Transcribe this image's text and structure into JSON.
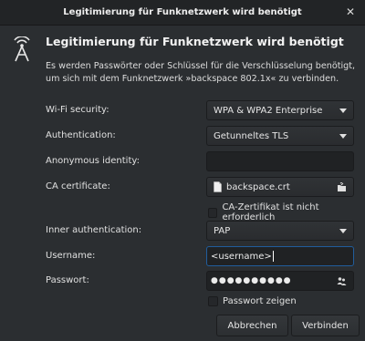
{
  "window": {
    "title": "Legitimierung für Funknetzwerk wird benötigt",
    "close_glyph": "✕"
  },
  "dialog": {
    "icon": "wifi-antenna-icon",
    "heading": "Legitimierung für Funknetzwerk wird benötigt",
    "description": "Es werden Passwörter oder Schlüssel für die Verschlüsselung benötigt, um sich mit dem Funknetzwerk »backspace 802.1x« zu verbinden."
  },
  "form": {
    "wifi_security": {
      "label": "Wi-Fi security:",
      "value": "WPA & WPA2 Enterprise"
    },
    "authentication": {
      "label": "Authentication:",
      "value": "Getunneltes TLS"
    },
    "anonymous_identity": {
      "label": "Anonymous identity:",
      "value": ""
    },
    "ca_certificate": {
      "label": "CA certificate:",
      "value": "backspace.crt"
    },
    "ca_not_required": {
      "label": "CA-Zertifikat ist nicht erforderlich",
      "checked": false
    },
    "inner_auth": {
      "label": "Inner authentication:",
      "value": "PAP"
    },
    "username": {
      "label": "Username:",
      "value": "<username>"
    },
    "password": {
      "label": "Passwort:",
      "value": "●●●●●●●●●●"
    },
    "show_password": {
      "label": "Passwort zeigen",
      "checked": false
    }
  },
  "buttons": {
    "cancel": "Abbrechen",
    "connect": "Verbinden"
  },
  "colors": {
    "background": "#2b2e31",
    "titlebar": "#222426",
    "focus_border": "#215d9c"
  }
}
